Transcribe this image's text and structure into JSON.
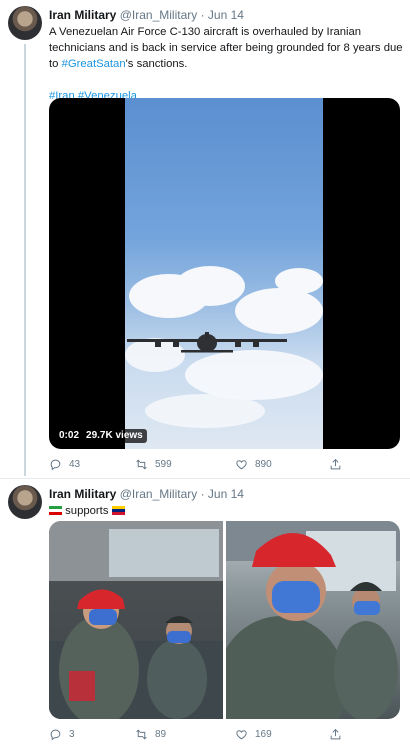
{
  "tweets": [
    {
      "name": "Iran Military",
      "handle": "@Iran_Military",
      "separator": "·",
      "date": "Jun 14",
      "text_main": "A Venezuelan Air Force C-130  aircraft is overhauled by Iranian technicians and is back in service after being grounded for 8 years due to ",
      "text_hashtag": "#GreatSatan",
      "text_tail": "'s sanctions.",
      "hashtags": [
        "#Iran",
        "#Venezuela"
      ],
      "video": {
        "time": "0:02",
        "views": "29.7K views"
      },
      "actions": {
        "replies": "43",
        "retweets": "599",
        "likes": "890"
      }
    },
    {
      "name": "Iran Military",
      "handle": "@Iran_Military",
      "separator": "·",
      "date": "Jun 14",
      "text": "supports",
      "actions": {
        "replies": "3",
        "retweets": "89",
        "likes": "169"
      }
    }
  ],
  "colors": {
    "link": "#1b95e0",
    "meta": "#657786",
    "border": "#e6ecf0",
    "iran_flag": [
      "#239f40",
      "#ffffff",
      "#da0000"
    ],
    "venezuela_flag": [
      "#ffcc00",
      "#00247d",
      "#cf142b"
    ]
  }
}
